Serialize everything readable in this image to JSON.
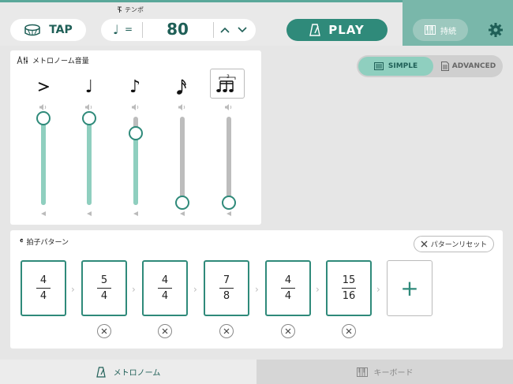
{
  "toolbar": {
    "tap_label": "TAP",
    "tempo_label": "テンポ",
    "tempo_eq": "=",
    "tempo_value": "80",
    "play_label": "PLAY",
    "sustain_label": "持続"
  },
  "volume_panel": {
    "title": "メトロノーム音量",
    "channels": [
      {
        "name": "accent",
        "level": 0.97
      },
      {
        "name": "quarter",
        "level": 0.97
      },
      {
        "name": "eighth",
        "level": 0.8
      },
      {
        "name": "sixteenth",
        "level": 0.0
      },
      {
        "name": "triplet",
        "level": 0.0
      }
    ]
  },
  "mode_toggle": {
    "simple_label": "SIMPLE",
    "advanced_label": "ADVANCED",
    "selected": "SIMPLE"
  },
  "beat_panel": {
    "title": "拍子パターン",
    "reset_label": "パターンリセット",
    "patterns": [
      {
        "num": "4",
        "den": "4"
      },
      {
        "num": "5",
        "den": "4"
      },
      {
        "num": "4",
        "den": "4"
      },
      {
        "num": "7",
        "den": "8"
      },
      {
        "num": "4",
        "den": "4"
      },
      {
        "num": "15",
        "den": "16"
      }
    ],
    "add_label": "+"
  },
  "bottom_nav": {
    "metronome_label": "メトロノーム",
    "keyboard_label": "キーボード"
  },
  "colors": {
    "accent": "#2f8a7a",
    "slider_fill": "#8fcfbf",
    "top_right_bg": "#79b7aa"
  }
}
